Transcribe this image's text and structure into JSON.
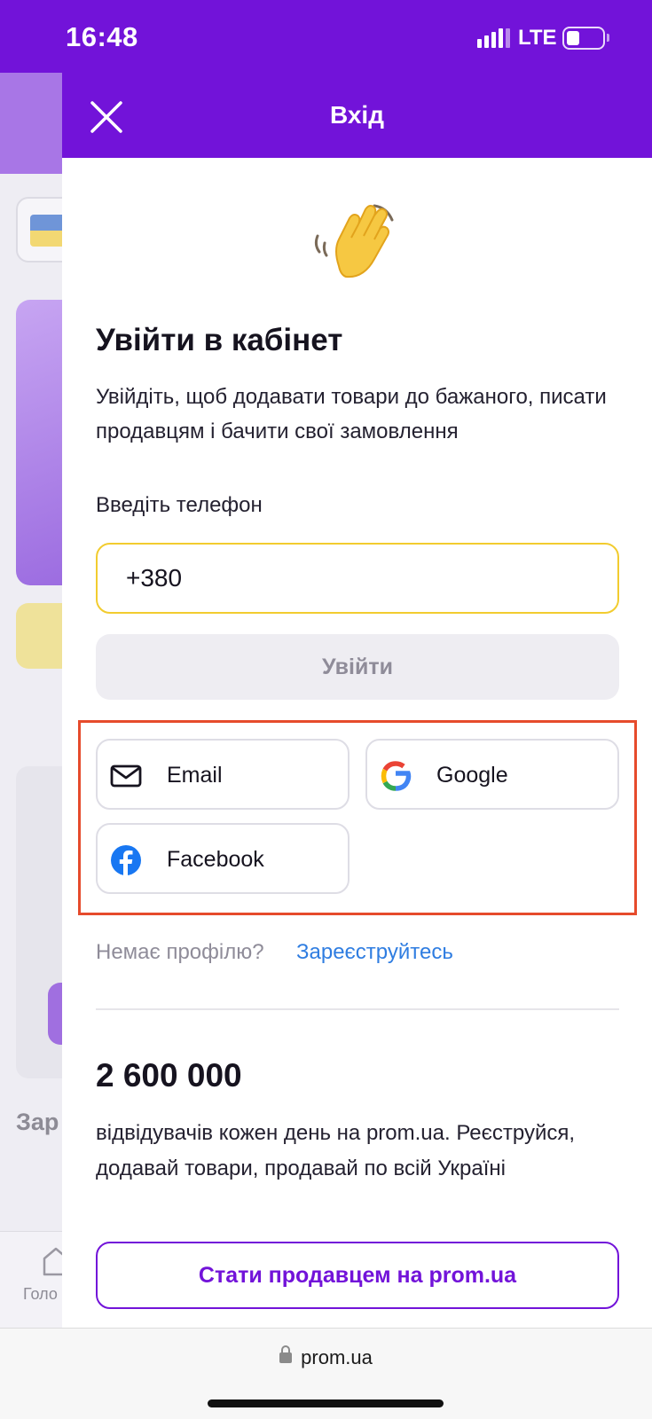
{
  "status_bar": {
    "time": "16:48",
    "network": "LTE",
    "icons": [
      "signal-icon",
      "battery-icon"
    ]
  },
  "background_page": {
    "partial_text": "Зар",
    "nav_partial_label": "Голо"
  },
  "drawer": {
    "header_title": "Вхід",
    "close_icon": "close-icon",
    "heading": "Увійти в кабінет",
    "subtitle": "Увійдіть, щоб додавати товари до бажаного, писати продавцям і бачити свої замовлення",
    "phone_label": "Введіть телефон",
    "phone_value": "+380",
    "login_button": "Увійти",
    "social": {
      "email": "Email",
      "google": "Google",
      "facebook": "Facebook"
    },
    "no_profile": "Немає профілю?",
    "register_link": "Зареєструйтесь",
    "visitors_count": "2 600 000",
    "visitors_text": "відвідувачів кожен день на prom.ua. Реєструйся, додавай товари, продавай по всій Україні",
    "seller_button": "Стати продавцем на prom.ua"
  },
  "browser": {
    "url": "prom.ua"
  },
  "colors": {
    "brand": "#7213d9",
    "input_border": "#f2cc2f",
    "link": "#2f7de1",
    "highlight_box": "#e64b2c"
  }
}
